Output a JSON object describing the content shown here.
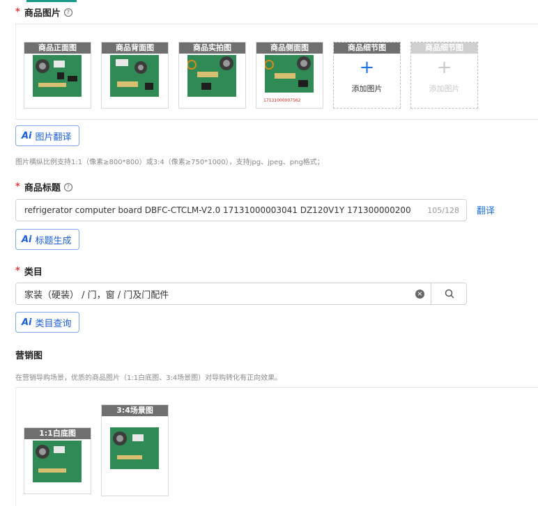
{
  "product_images": {
    "label": "商品图片",
    "thumbs": [
      {
        "caption": "商品正面图"
      },
      {
        "caption": "商品背面图"
      },
      {
        "caption": "商品实拍图"
      },
      {
        "caption": "商品侧面图",
        "code": "17131000007562"
      }
    ],
    "add_slots": [
      {
        "caption": "商品细节图",
        "text": "添加图片"
      },
      {
        "caption": "商品细节图",
        "text": "添加图片"
      }
    ],
    "translate_button": "图片翻译",
    "hint": "图片横纵比例支持1:1（像素≥800*800）或3:4（像素≥750*1000），支持jpg、jpeg、png格式；"
  },
  "product_title": {
    "label": "商品标题",
    "value": "refrigerator computer board DBFC-CTCLM-V2.0 17131000003041 DZ120V1Y 171300000200",
    "counter": "105/128",
    "translate_link": "翻译",
    "generate_button": "标题生成"
  },
  "category": {
    "label": "类目",
    "value": "家装（硬装） / 门，窗 / 门及门配件",
    "query_button": "类目查询"
  },
  "marketing": {
    "label": "营销图",
    "hint": "在营销导购场景，优质的商品图片（1:1白底图、3:4场景图）对导购转化有正向效果。",
    "images": [
      {
        "caption": "1:1白底图"
      },
      {
        "caption": "3:4场景图"
      }
    ]
  },
  "symbols": {
    "required": "*",
    "help": "?",
    "ai": "Ai",
    "plus": "+",
    "clear": "×"
  }
}
